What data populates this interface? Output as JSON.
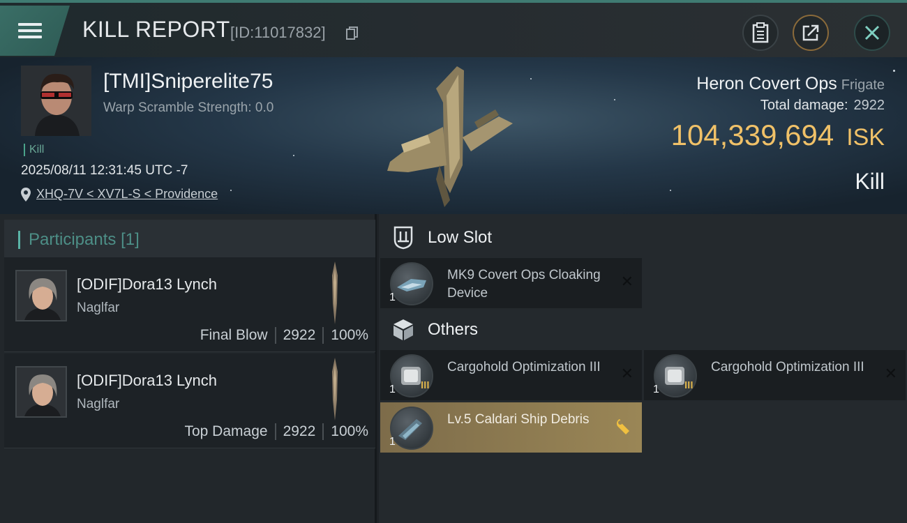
{
  "header": {
    "title": "KILL REPORT",
    "report_id": "[ID:11017832]"
  },
  "victim": {
    "pilot_name": "[TMI]Sniperelite75",
    "warp_scramble": "Warp Scramble Strength: 0.0",
    "tag": "Kill",
    "timestamp": "2025/08/11 12:31:45 UTC -7",
    "location": "XHQ-7V < XV7L-S < Providence",
    "ship_name": "Heron Covert Ops",
    "ship_class": "Frigate",
    "total_damage_label": "Total damage:",
    "total_damage": "2922",
    "isk_value": "104,339,694",
    "isk_unit": "ISK",
    "result": "Kill"
  },
  "participants": {
    "label": "Participants",
    "count": "[1]",
    "items": [
      {
        "name": "[ODIF]Dora13 Lynch",
        "ship": "Naglfar",
        "role": "Final Blow",
        "damage": "2922",
        "percent": "100%"
      },
      {
        "name": "[ODIF]Dora13 Lynch",
        "ship": "Naglfar",
        "role": "Top Damage",
        "damage": "2922",
        "percent": "100%"
      }
    ]
  },
  "fitting": {
    "low_slot": {
      "label": "Low Slot",
      "items": [
        {
          "qty": "1",
          "name": "MK9 Covert Ops Cloaking Device"
        }
      ]
    },
    "others": {
      "label": "Others",
      "items": [
        {
          "qty": "1",
          "tier": "III",
          "name": "Cargohold Optimization III"
        },
        {
          "qty": "1",
          "tier": "III",
          "name": "Cargohold Optimization III"
        },
        {
          "qty": "1",
          "name": "Lv.5 Caldari Ship Debris"
        }
      ]
    }
  },
  "icons": {
    "menu": "hamburger-menu-icon",
    "copy": "copy-icon",
    "clipboard": "clipboard-icon",
    "share": "share-icon",
    "close": "close-icon",
    "location": "location-pin-icon",
    "low_slot": "low-slot-icon",
    "others": "cube-icon",
    "remove": "x-icon",
    "wrench": "wrench-icon"
  },
  "colors": {
    "accent": "#4aa38a",
    "isk": "#f0c168",
    "highlight": "#8e7c52"
  }
}
